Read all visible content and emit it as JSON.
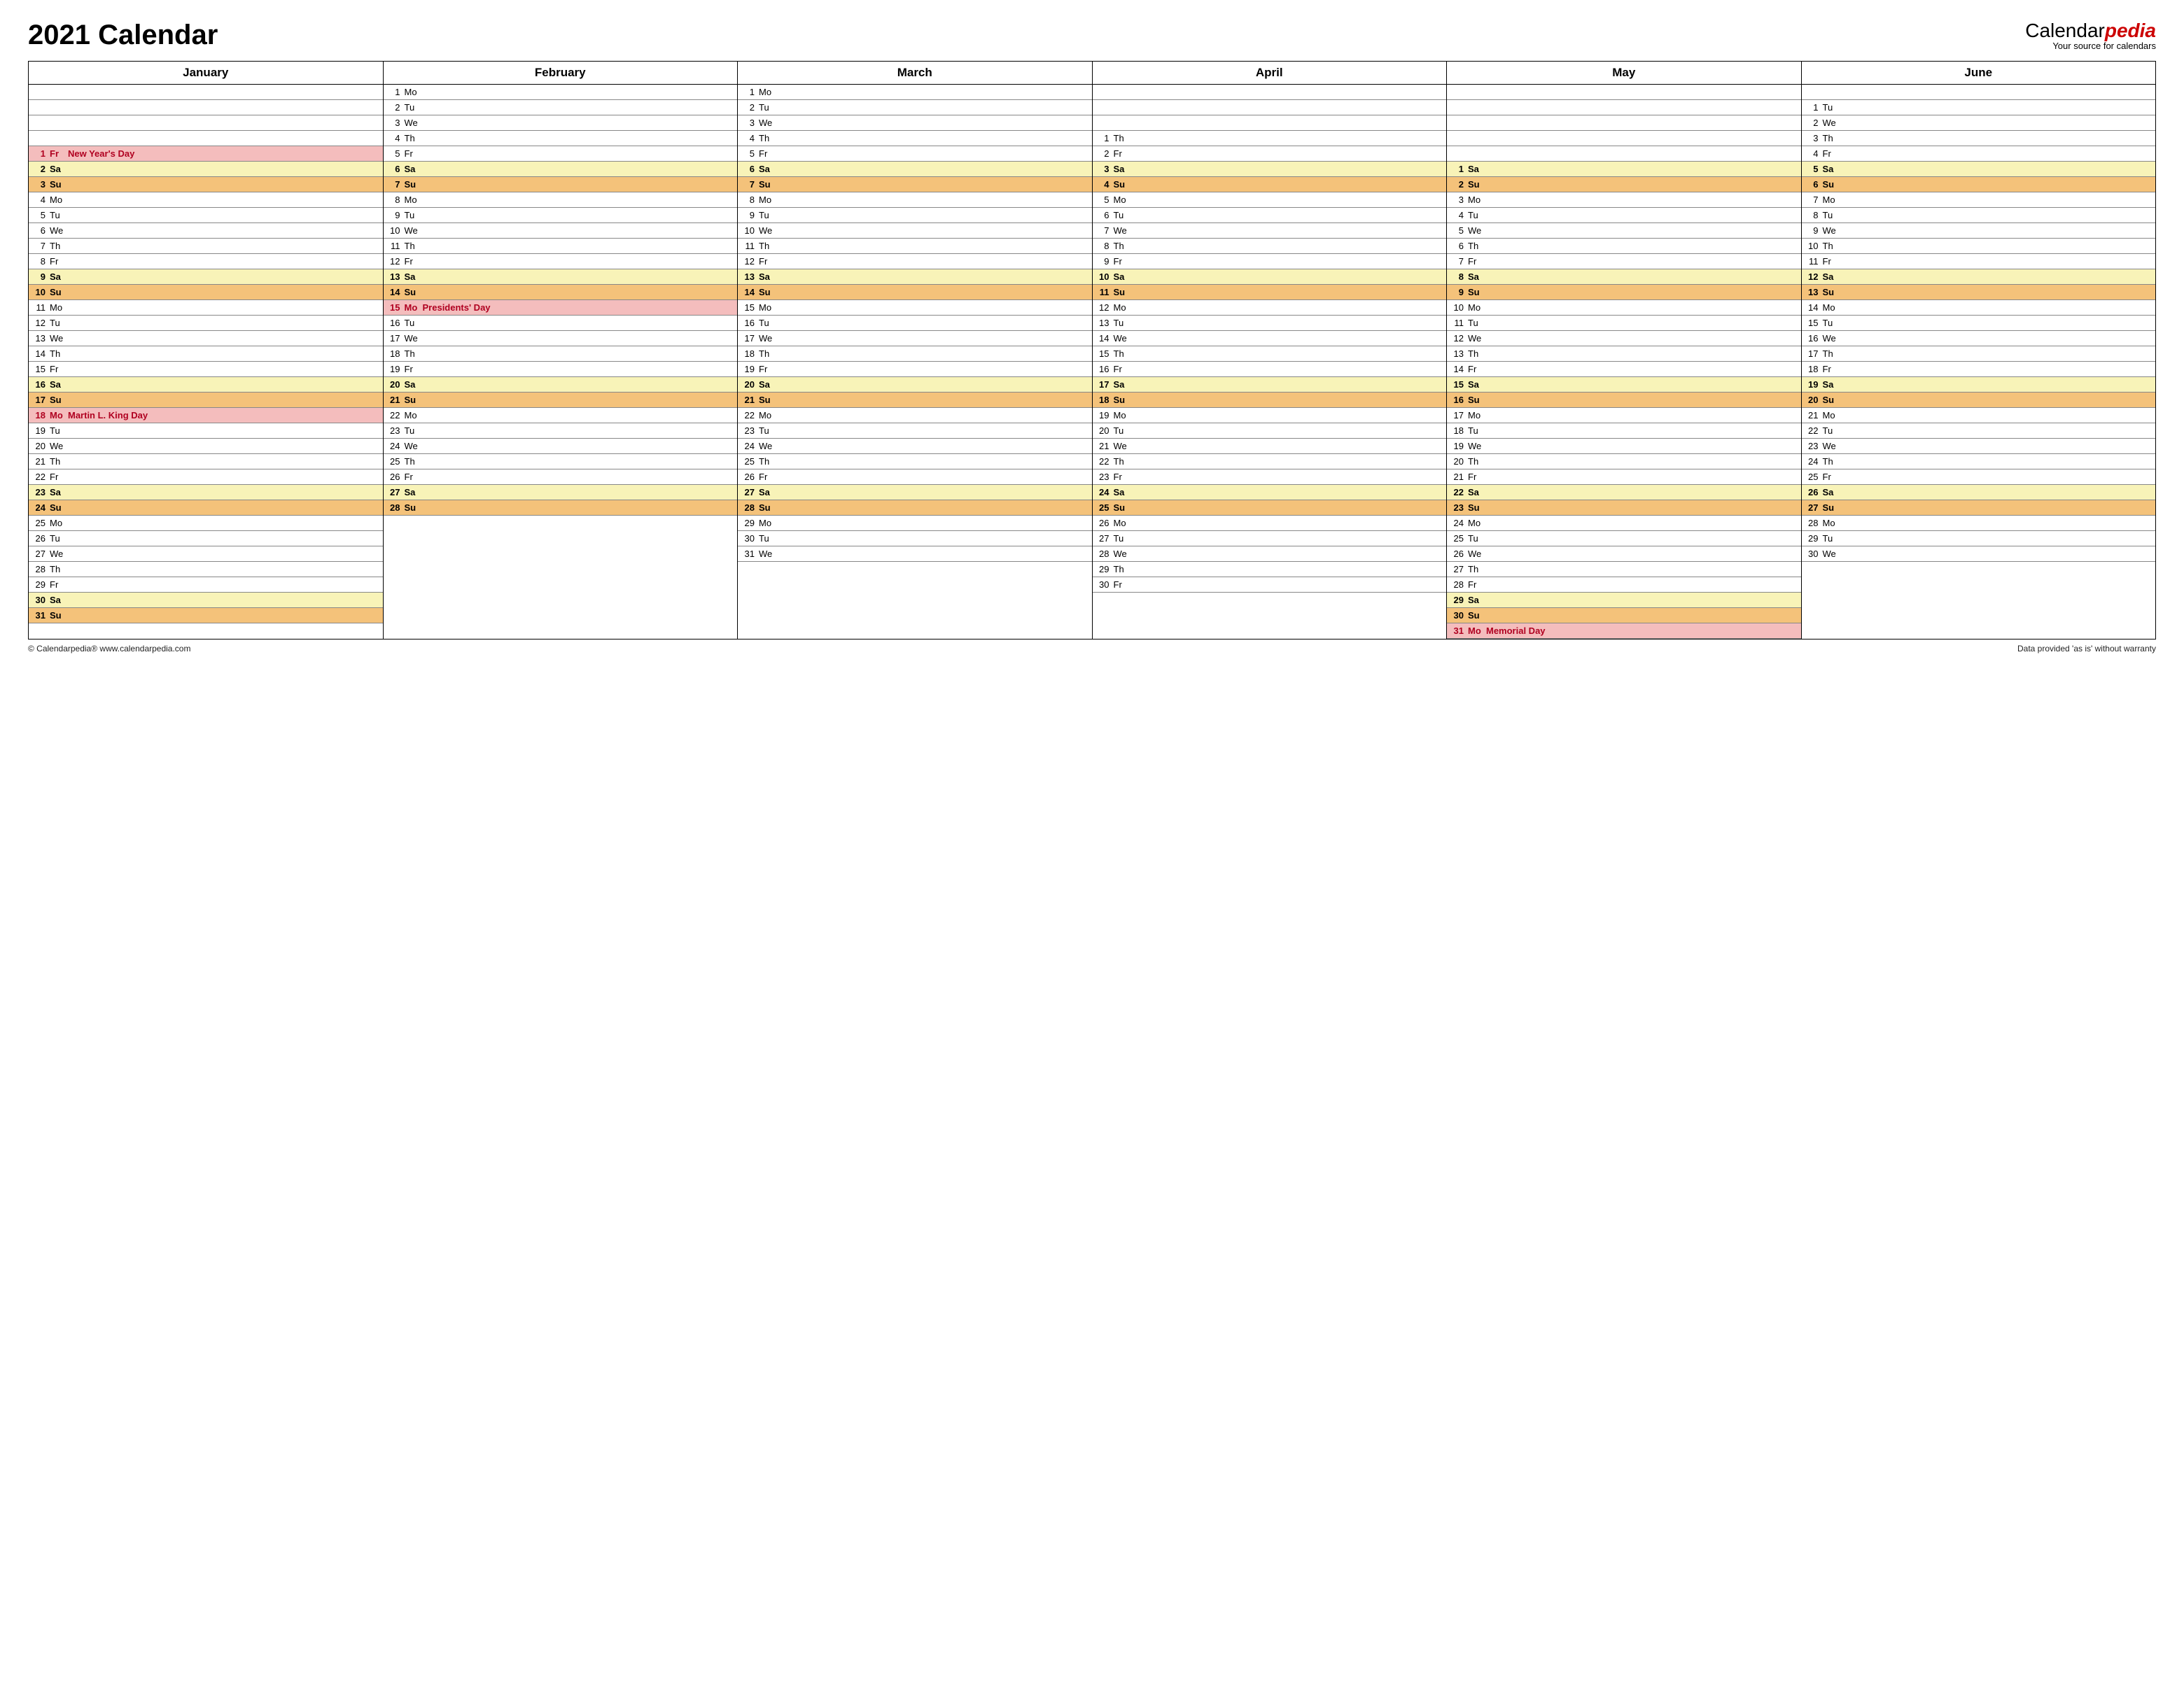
{
  "title": "2021 Calendar",
  "logo": {
    "brand_a": "Calendar",
    "brand_b": "pedia",
    "tagline": "Your source for calendars"
  },
  "footer_left": "© Calendarpedia®   www.calendarpedia.com",
  "footer_right": "Data provided 'as is' without warranty",
  "months": [
    "January",
    "February",
    "March",
    "April",
    "May",
    "June"
  ],
  "weekdays": [
    "Mo",
    "Tu",
    "We",
    "Th",
    "Fr",
    "Sa",
    "Su"
  ],
  "offsets": {
    "January": 4,
    "February": 0,
    "March": 0,
    "April": 3,
    "May": 5,
    "June": 1
  },
  "lengths": {
    "January": 31,
    "February": 28,
    "March": 31,
    "April": 30,
    "May": 31,
    "June": 30
  },
  "holidays": {
    "January": {
      "1": "New Year's Day",
      "18": "Martin L. King Day"
    },
    "February": {
      "15": "Presidents' Day"
    },
    "May": {
      "31": "Memorial Day"
    }
  },
  "grid_rows": 36
}
